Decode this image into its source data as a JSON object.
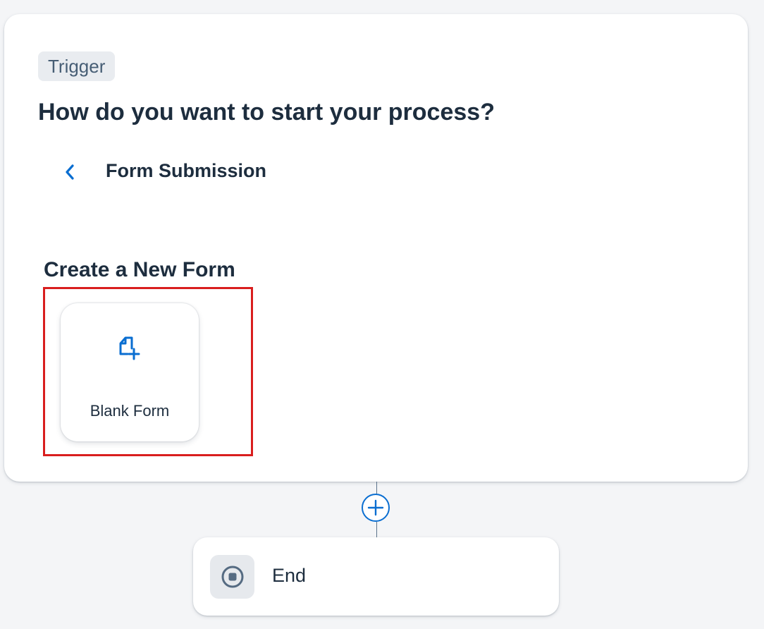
{
  "trigger_card": {
    "tag": "Trigger",
    "question": "How do you want to start your process?",
    "back_icon": "chevron-left-icon",
    "section_title": "Form Submission",
    "create_heading": "Create a New Form",
    "tiles": [
      {
        "label": "Blank Form",
        "icon": "add-document-icon"
      }
    ]
  },
  "flow": {
    "add_icon": "plus-circle-icon",
    "end_step": {
      "label": "End",
      "icon": "stop-circle-icon"
    }
  },
  "colors": {
    "accent": "#0a6ed1",
    "highlight": "#d91e1e",
    "text": "#1d2d3e",
    "tag_bg": "#e9ecf0",
    "tag_text": "#475e75",
    "background": "#f4f5f7"
  }
}
